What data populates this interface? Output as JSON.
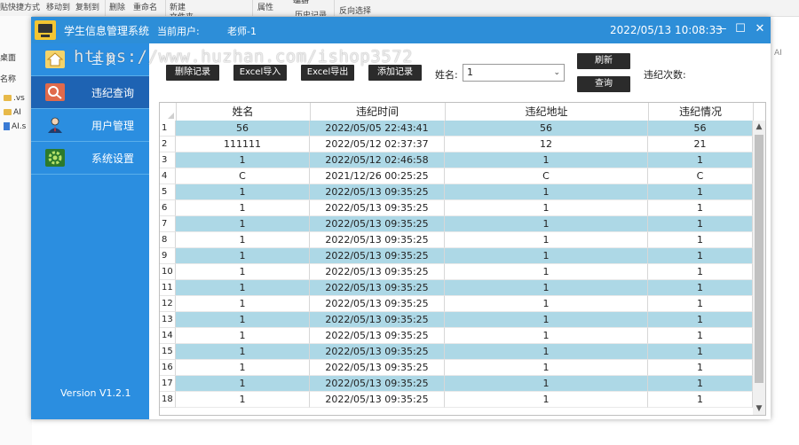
{
  "background": {
    "ribbon": [
      "贴快捷方式",
      "移动到",
      "复制到",
      "删除",
      "重命名",
      "新建",
      "文件夹",
      "属性",
      "编辑",
      "历史记录",
      "反向选择"
    ],
    "left_items": [
      "桌面",
      "名称",
      ".vs",
      "AI",
      "AI.s"
    ],
    "right_text": "AI"
  },
  "window": {
    "title": "学生信息管理系统",
    "user_label": "当前用户:",
    "user": "老师-1",
    "datetime": "2022/05/13 10:08:33",
    "minimize": "—",
    "maximize": "☐",
    "close": "✕"
  },
  "watermark": "https://www.huzhan.com/ishop3572",
  "sidebar": {
    "items": [
      {
        "label": "主 页",
        "icon": "home-icon"
      },
      {
        "label": "违纪查询",
        "icon": "search-icon"
      },
      {
        "label": "用户管理",
        "icon": "user-icon"
      },
      {
        "label": "系统设置",
        "icon": "gear-icon"
      }
    ],
    "version": "Version V1.2.1"
  },
  "toolbar": {
    "delete": "删除记录",
    "import": "Excel导入",
    "export": "Excel导出",
    "add": "添加记录",
    "name_label": "姓名:",
    "name_value": "1",
    "refresh": "刷新",
    "query": "查询",
    "count_label": "违纪次数:"
  },
  "table": {
    "columns": [
      "姓名",
      "违纪时间",
      "违纪地址",
      "违纪情况"
    ],
    "rows": [
      [
        "1",
        "56",
        "2022/05/05 22:43:41",
        "56",
        "56"
      ],
      [
        "2",
        "111111",
        "2022/05/12 02:37:37",
        "12",
        "21"
      ],
      [
        "3",
        "1",
        "2022/05/12 02:46:58",
        "1",
        "1"
      ],
      [
        "4",
        "C",
        "2021/12/26 00:25:25",
        "C",
        "C"
      ],
      [
        "5",
        "1",
        "2022/05/13 09:35:25",
        "1",
        "1"
      ],
      [
        "6",
        "1",
        "2022/05/13 09:35:25",
        "1",
        "1"
      ],
      [
        "7",
        "1",
        "2022/05/13 09:35:25",
        "1",
        "1"
      ],
      [
        "8",
        "1",
        "2022/05/13 09:35:25",
        "1",
        "1"
      ],
      [
        "9",
        "1",
        "2022/05/13 09:35:25",
        "1",
        "1"
      ],
      [
        "10",
        "1",
        "2022/05/13 09:35:25",
        "1",
        "1"
      ],
      [
        "11",
        "1",
        "2022/05/13 09:35:25",
        "1",
        "1"
      ],
      [
        "12",
        "1",
        "2022/05/13 09:35:25",
        "1",
        "1"
      ],
      [
        "13",
        "1",
        "2022/05/13 09:35:25",
        "1",
        "1"
      ],
      [
        "14",
        "1",
        "2022/05/13 09:35:25",
        "1",
        "1"
      ],
      [
        "15",
        "1",
        "2022/05/13 09:35:25",
        "1",
        "1"
      ],
      [
        "16",
        "1",
        "2022/05/13 09:35:25",
        "1",
        "1"
      ],
      [
        "17",
        "1",
        "2022/05/13 09:35:25",
        "1",
        "1"
      ],
      [
        "18",
        "1",
        "2022/05/13 09:35:25",
        "1",
        "1"
      ]
    ]
  },
  "colors": {
    "titlebar": "#2d8ed8",
    "sidebar": "#2b8ee0",
    "sidebar_active": "#1e63b3",
    "row_alt": "#add8e6",
    "button": "#2b2b2b"
  }
}
